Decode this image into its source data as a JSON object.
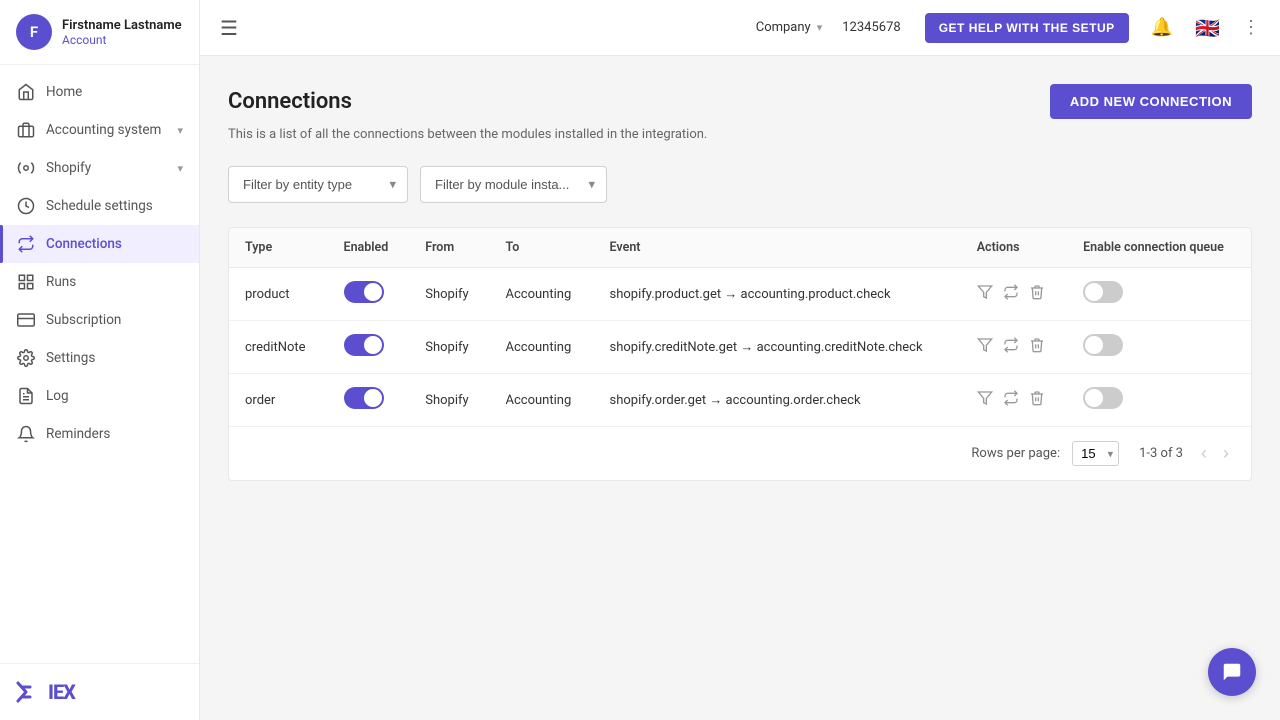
{
  "sidebar": {
    "user": {
      "initials": "F",
      "name": "Firstname Lastname",
      "role": "Account"
    },
    "nav_items": [
      {
        "id": "home",
        "label": "Home",
        "icon": "home-icon",
        "active": false,
        "has_chevron": false
      },
      {
        "id": "accounting",
        "label": "Accounting system",
        "icon": "building-icon",
        "active": false,
        "has_chevron": true
      },
      {
        "id": "shopify",
        "label": "Shopify",
        "icon": "gear-icon",
        "active": false,
        "has_chevron": true
      },
      {
        "id": "schedule",
        "label": "Schedule settings",
        "icon": "clock-icon",
        "active": false,
        "has_chevron": false
      },
      {
        "id": "connections",
        "label": "Connections",
        "icon": "connections-icon",
        "active": true,
        "has_chevron": false
      },
      {
        "id": "runs",
        "label": "Runs",
        "icon": "grid-icon",
        "active": false,
        "has_chevron": false
      },
      {
        "id": "subscription",
        "label": "Subscription",
        "icon": "card-icon",
        "active": false,
        "has_chevron": false
      },
      {
        "id": "settings",
        "label": "Settings",
        "icon": "settings-icon",
        "active": false,
        "has_chevron": false
      },
      {
        "id": "log",
        "label": "Log",
        "icon": "log-icon",
        "active": false,
        "has_chevron": false
      },
      {
        "id": "reminders",
        "label": "Reminders",
        "icon": "bell-icon",
        "active": false,
        "has_chevron": false
      }
    ],
    "logo": "×IEX"
  },
  "topbar": {
    "company_label": "Company",
    "company_id": "12345678",
    "help_button": "GET HELP WITH THE SETUP",
    "flag": "🇬🇧"
  },
  "page": {
    "title": "Connections",
    "description": "This is a list of all the connections between the modules installed in the integration.",
    "add_button": "ADD NEW CONNECTION"
  },
  "filters": {
    "entity_type_placeholder": "Filter by entity type",
    "module_placeholder": "Filter by module insta..."
  },
  "table": {
    "columns": [
      "Type",
      "Enabled",
      "From",
      "To",
      "Event",
      "Actions",
      "Enable connection queue"
    ],
    "rows": [
      {
        "type": "product",
        "enabled": true,
        "from": "Shopify",
        "to": "Accounting",
        "event": "shopify.product.get → accounting.product.check",
        "queue_enabled": false
      },
      {
        "type": "creditNote",
        "enabled": true,
        "from": "Shopify",
        "to": "Accounting",
        "event": "shopify.creditNote.get → accounting.creditNote.check",
        "queue_enabled": false
      },
      {
        "type": "order",
        "enabled": true,
        "from": "Shopify",
        "to": "Accounting",
        "event": "shopify.order.get → accounting.order.check",
        "queue_enabled": false
      }
    ]
  },
  "pagination": {
    "rows_per_page_label": "Rows per page:",
    "rows_per_page": "15",
    "page_info": "1-3 of 3"
  }
}
